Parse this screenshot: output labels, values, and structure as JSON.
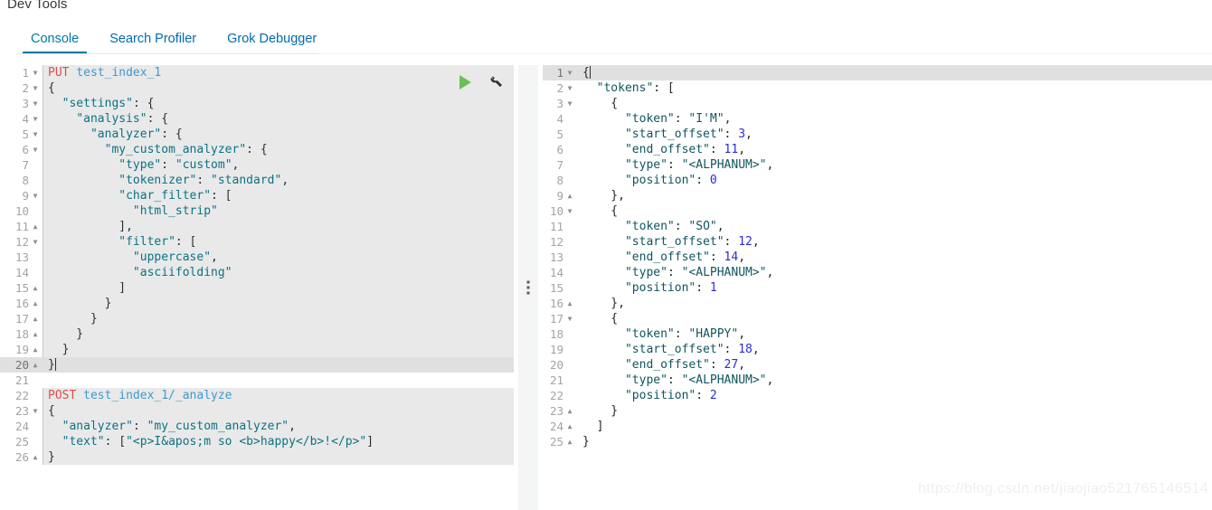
{
  "app": {
    "title": "Dev Tools"
  },
  "tabs": [
    {
      "label": "Console",
      "active": true
    },
    {
      "label": "Search Profiler",
      "active": false
    },
    {
      "label": "Grok Debugger",
      "active": false
    }
  ],
  "toolbar": {
    "play_label": "▶",
    "wrench_label": "🔧",
    "play_icon": "play-icon",
    "wrench_icon": "wrench-icon"
  },
  "request_editor": {
    "cursor_line": 20,
    "lines": [
      {
        "n": 1,
        "fold": "open",
        "text": "PUT test_index_1",
        "tokens": [
          {
            "t": "PUT",
            "c": "k-method"
          },
          {
            "t": " ",
            "c": "k-punc"
          },
          {
            "t": "test_index_1",
            "c": "k-url"
          }
        ]
      },
      {
        "n": 2,
        "fold": "open",
        "text": "{",
        "tokens": [
          {
            "t": "{",
            "c": "k-punc"
          }
        ]
      },
      {
        "n": 3,
        "fold": "open",
        "text": "  \"settings\": {",
        "tokens": [
          {
            "t": "  ",
            "c": "k-punc"
          },
          {
            "t": "\"settings\"",
            "c": "k-key"
          },
          {
            "t": ": {",
            "c": "k-punc"
          }
        ]
      },
      {
        "n": 4,
        "fold": "open",
        "text": "    \"analysis\": {",
        "tokens": [
          {
            "t": "    ",
            "c": "k-punc"
          },
          {
            "t": "\"analysis\"",
            "c": "k-key"
          },
          {
            "t": ": {",
            "c": "k-punc"
          }
        ]
      },
      {
        "n": 5,
        "fold": "open",
        "text": "      \"analyzer\": {",
        "tokens": [
          {
            "t": "      ",
            "c": "k-punc"
          },
          {
            "t": "\"analyzer\"",
            "c": "k-key"
          },
          {
            "t": ": {",
            "c": "k-punc"
          }
        ]
      },
      {
        "n": 6,
        "fold": "open",
        "text": "        \"my_custom_analyzer\": {",
        "tokens": [
          {
            "t": "        ",
            "c": "k-punc"
          },
          {
            "t": "\"my_custom_analyzer\"",
            "c": "k-key"
          },
          {
            "t": ": {",
            "c": "k-punc"
          }
        ]
      },
      {
        "n": 7,
        "fold": "none",
        "text": "          \"type\": \"custom\",",
        "tokens": [
          {
            "t": "          ",
            "c": "k-punc"
          },
          {
            "t": "\"type\"",
            "c": "k-key"
          },
          {
            "t": ": ",
            "c": "k-punc"
          },
          {
            "t": "\"custom\"",
            "c": "k-str"
          },
          {
            "t": ",",
            "c": "k-punc"
          }
        ]
      },
      {
        "n": 8,
        "fold": "none",
        "text": "          \"tokenizer\": \"standard\",",
        "tokens": [
          {
            "t": "          ",
            "c": "k-punc"
          },
          {
            "t": "\"tokenizer\"",
            "c": "k-key"
          },
          {
            "t": ": ",
            "c": "k-punc"
          },
          {
            "t": "\"standard\"",
            "c": "k-str"
          },
          {
            "t": ",",
            "c": "k-punc"
          }
        ]
      },
      {
        "n": 9,
        "fold": "open",
        "text": "          \"char_filter\": [",
        "tokens": [
          {
            "t": "          ",
            "c": "k-punc"
          },
          {
            "t": "\"char_filter\"",
            "c": "k-key"
          },
          {
            "t": ": [",
            "c": "k-punc"
          }
        ]
      },
      {
        "n": 10,
        "fold": "none",
        "text": "            \"html_strip\"",
        "tokens": [
          {
            "t": "            ",
            "c": "k-punc"
          },
          {
            "t": "\"html_strip\"",
            "c": "k-str"
          }
        ]
      },
      {
        "n": 11,
        "fold": "close",
        "text": "          ],",
        "tokens": [
          {
            "t": "          ],",
            "c": "k-punc"
          }
        ]
      },
      {
        "n": 12,
        "fold": "open",
        "text": "          \"filter\": [",
        "tokens": [
          {
            "t": "          ",
            "c": "k-punc"
          },
          {
            "t": "\"filter\"",
            "c": "k-key"
          },
          {
            "t": ": [",
            "c": "k-punc"
          }
        ]
      },
      {
        "n": 13,
        "fold": "none",
        "text": "            \"uppercase\",",
        "tokens": [
          {
            "t": "            ",
            "c": "k-punc"
          },
          {
            "t": "\"uppercase\"",
            "c": "k-str"
          },
          {
            "t": ",",
            "c": "k-punc"
          }
        ]
      },
      {
        "n": 14,
        "fold": "none",
        "text": "            \"asciifolding\"",
        "tokens": [
          {
            "t": "            ",
            "c": "k-punc"
          },
          {
            "t": "\"asciifolding\"",
            "c": "k-str"
          }
        ]
      },
      {
        "n": 15,
        "fold": "close",
        "text": "          ]",
        "tokens": [
          {
            "t": "          ]",
            "c": "k-punc"
          }
        ]
      },
      {
        "n": 16,
        "fold": "close",
        "text": "        }",
        "tokens": [
          {
            "t": "        }",
            "c": "k-punc"
          }
        ]
      },
      {
        "n": 17,
        "fold": "close",
        "text": "      }",
        "tokens": [
          {
            "t": "      }",
            "c": "k-punc"
          }
        ]
      },
      {
        "n": 18,
        "fold": "close",
        "text": "    }",
        "tokens": [
          {
            "t": "    }",
            "c": "k-punc"
          }
        ]
      },
      {
        "n": 19,
        "fold": "close",
        "text": "  }",
        "tokens": [
          {
            "t": "  }",
            "c": "k-punc"
          }
        ]
      },
      {
        "n": 20,
        "fold": "close",
        "text": "}",
        "tokens": [
          {
            "t": "}",
            "c": "k-punc"
          }
        ],
        "cursor": true
      },
      {
        "n": 21,
        "fold": "none",
        "text": "",
        "tokens": []
      },
      {
        "n": 22,
        "fold": "none",
        "text": "POST test_index_1/_analyze",
        "tokens": [
          {
            "t": "POST",
            "c": "k-method"
          },
          {
            "t": " ",
            "c": "k-punc"
          },
          {
            "t": "test_index_1/_analyze",
            "c": "k-url"
          }
        ]
      },
      {
        "n": 23,
        "fold": "open",
        "text": "{",
        "tokens": [
          {
            "t": "{",
            "c": "k-punc"
          }
        ]
      },
      {
        "n": 24,
        "fold": "none",
        "text": "  \"analyzer\": \"my_custom_analyzer\",",
        "tokens": [
          {
            "t": "  ",
            "c": "k-punc"
          },
          {
            "t": "\"analyzer\"",
            "c": "k-key"
          },
          {
            "t": ": ",
            "c": "k-punc"
          },
          {
            "t": "\"my_custom_analyzer\"",
            "c": "k-str"
          },
          {
            "t": ",",
            "c": "k-punc"
          }
        ]
      },
      {
        "n": 25,
        "fold": "none",
        "text": "  \"text\": [\"<p>I&apos;m so <b>happy</b>!</p>\"]",
        "tokens": [
          {
            "t": "  ",
            "c": "k-punc"
          },
          {
            "t": "\"text\"",
            "c": "k-key"
          },
          {
            "t": ": [",
            "c": "k-punc"
          },
          {
            "t": "\"<p>I&apos;m so <b>happy</b>!</p>\"",
            "c": "k-str"
          },
          {
            "t": "]",
            "c": "k-punc"
          }
        ]
      },
      {
        "n": 26,
        "fold": "close",
        "text": "}",
        "tokens": [
          {
            "t": "}",
            "c": "k-punc"
          }
        ]
      }
    ]
  },
  "response_editor": {
    "cursor_line": 1,
    "lines": [
      {
        "n": 1,
        "fold": "open",
        "text": "{",
        "tokens": [
          {
            "t": "{",
            "c": "r-punc"
          }
        ],
        "cursor": true
      },
      {
        "n": 2,
        "fold": "open",
        "text": "  \"tokens\": [",
        "tokens": [
          {
            "t": "  ",
            "c": "r-punc"
          },
          {
            "t": "\"tokens\"",
            "c": "r-key"
          },
          {
            "t": ": [",
            "c": "r-punc"
          }
        ]
      },
      {
        "n": 3,
        "fold": "open",
        "text": "    {",
        "tokens": [
          {
            "t": "    {",
            "c": "r-punc"
          }
        ]
      },
      {
        "n": 4,
        "fold": "none",
        "text": "      \"token\": \"I'M\",",
        "tokens": [
          {
            "t": "      ",
            "c": "r-punc"
          },
          {
            "t": "\"token\"",
            "c": "r-key"
          },
          {
            "t": ": ",
            "c": "r-punc"
          },
          {
            "t": "\"I'M\"",
            "c": "r-str"
          },
          {
            "t": ",",
            "c": "r-punc"
          }
        ]
      },
      {
        "n": 5,
        "fold": "none",
        "text": "      \"start_offset\": 3,",
        "tokens": [
          {
            "t": "      ",
            "c": "r-punc"
          },
          {
            "t": "\"start_offset\"",
            "c": "r-key"
          },
          {
            "t": ": ",
            "c": "r-punc"
          },
          {
            "t": "3",
            "c": "r-num"
          },
          {
            "t": ",",
            "c": "r-punc"
          }
        ]
      },
      {
        "n": 6,
        "fold": "none",
        "text": "      \"end_offset\": 11,",
        "tokens": [
          {
            "t": "      ",
            "c": "r-punc"
          },
          {
            "t": "\"end_offset\"",
            "c": "r-key"
          },
          {
            "t": ": ",
            "c": "r-punc"
          },
          {
            "t": "11",
            "c": "r-num"
          },
          {
            "t": ",",
            "c": "r-punc"
          }
        ]
      },
      {
        "n": 7,
        "fold": "none",
        "text": "      \"type\": \"<ALPHANUM>\",",
        "tokens": [
          {
            "t": "      ",
            "c": "r-punc"
          },
          {
            "t": "\"type\"",
            "c": "r-key"
          },
          {
            "t": ": ",
            "c": "r-punc"
          },
          {
            "t": "\"<ALPHANUM>\"",
            "c": "r-str"
          },
          {
            "t": ",",
            "c": "r-punc"
          }
        ]
      },
      {
        "n": 8,
        "fold": "none",
        "text": "      \"position\": 0",
        "tokens": [
          {
            "t": "      ",
            "c": "r-punc"
          },
          {
            "t": "\"position\"",
            "c": "r-key"
          },
          {
            "t": ": ",
            "c": "r-punc"
          },
          {
            "t": "0",
            "c": "r-num"
          }
        ]
      },
      {
        "n": 9,
        "fold": "close",
        "text": "    },",
        "tokens": [
          {
            "t": "    },",
            "c": "r-punc"
          }
        ]
      },
      {
        "n": 10,
        "fold": "open",
        "text": "    {",
        "tokens": [
          {
            "t": "    {",
            "c": "r-punc"
          }
        ]
      },
      {
        "n": 11,
        "fold": "none",
        "text": "      \"token\": \"SO\",",
        "tokens": [
          {
            "t": "      ",
            "c": "r-punc"
          },
          {
            "t": "\"token\"",
            "c": "r-key"
          },
          {
            "t": ": ",
            "c": "r-punc"
          },
          {
            "t": "\"SO\"",
            "c": "r-str"
          },
          {
            "t": ",",
            "c": "r-punc"
          }
        ]
      },
      {
        "n": 12,
        "fold": "none",
        "text": "      \"start_offset\": 12,",
        "tokens": [
          {
            "t": "      ",
            "c": "r-punc"
          },
          {
            "t": "\"start_offset\"",
            "c": "r-key"
          },
          {
            "t": ": ",
            "c": "r-punc"
          },
          {
            "t": "12",
            "c": "r-num"
          },
          {
            "t": ",",
            "c": "r-punc"
          }
        ]
      },
      {
        "n": 13,
        "fold": "none",
        "text": "      \"end_offset\": 14,",
        "tokens": [
          {
            "t": "      ",
            "c": "r-punc"
          },
          {
            "t": "\"end_offset\"",
            "c": "r-key"
          },
          {
            "t": ": ",
            "c": "r-punc"
          },
          {
            "t": "14",
            "c": "r-num"
          },
          {
            "t": ",",
            "c": "r-punc"
          }
        ]
      },
      {
        "n": 14,
        "fold": "none",
        "text": "      \"type\": \"<ALPHANUM>\",",
        "tokens": [
          {
            "t": "      ",
            "c": "r-punc"
          },
          {
            "t": "\"type\"",
            "c": "r-key"
          },
          {
            "t": ": ",
            "c": "r-punc"
          },
          {
            "t": "\"<ALPHANUM>\"",
            "c": "r-str"
          },
          {
            "t": ",",
            "c": "r-punc"
          }
        ]
      },
      {
        "n": 15,
        "fold": "none",
        "text": "      \"position\": 1",
        "tokens": [
          {
            "t": "      ",
            "c": "r-punc"
          },
          {
            "t": "\"position\"",
            "c": "r-key"
          },
          {
            "t": ": ",
            "c": "r-punc"
          },
          {
            "t": "1",
            "c": "r-num"
          }
        ]
      },
      {
        "n": 16,
        "fold": "close",
        "text": "    },",
        "tokens": [
          {
            "t": "    },",
            "c": "r-punc"
          }
        ]
      },
      {
        "n": 17,
        "fold": "open",
        "text": "    {",
        "tokens": [
          {
            "t": "    {",
            "c": "r-punc"
          }
        ]
      },
      {
        "n": 18,
        "fold": "none",
        "text": "      \"token\": \"HAPPY\",",
        "tokens": [
          {
            "t": "      ",
            "c": "r-punc"
          },
          {
            "t": "\"token\"",
            "c": "r-key"
          },
          {
            "t": ": ",
            "c": "r-punc"
          },
          {
            "t": "\"HAPPY\"",
            "c": "r-str"
          },
          {
            "t": ",",
            "c": "r-punc"
          }
        ]
      },
      {
        "n": 19,
        "fold": "none",
        "text": "      \"start_offset\": 18,",
        "tokens": [
          {
            "t": "      ",
            "c": "r-punc"
          },
          {
            "t": "\"start_offset\"",
            "c": "r-key"
          },
          {
            "t": ": ",
            "c": "r-punc"
          },
          {
            "t": "18",
            "c": "r-num"
          },
          {
            "t": ",",
            "c": "r-punc"
          }
        ]
      },
      {
        "n": 20,
        "fold": "none",
        "text": "      \"end_offset\": 27,",
        "tokens": [
          {
            "t": "      ",
            "c": "r-punc"
          },
          {
            "t": "\"end_offset\"",
            "c": "r-key"
          },
          {
            "t": ": ",
            "c": "r-punc"
          },
          {
            "t": "27",
            "c": "r-num"
          },
          {
            "t": ",",
            "c": "r-punc"
          }
        ]
      },
      {
        "n": 21,
        "fold": "none",
        "text": "      \"type\": \"<ALPHANUM>\",",
        "tokens": [
          {
            "t": "      ",
            "c": "r-punc"
          },
          {
            "t": "\"type\"",
            "c": "r-key"
          },
          {
            "t": ": ",
            "c": "r-punc"
          },
          {
            "t": "\"<ALPHANUM>\"",
            "c": "r-str"
          },
          {
            "t": ",",
            "c": "r-punc"
          }
        ]
      },
      {
        "n": 22,
        "fold": "none",
        "text": "      \"position\": 2",
        "tokens": [
          {
            "t": "      ",
            "c": "r-punc"
          },
          {
            "t": "\"position\"",
            "c": "r-key"
          },
          {
            "t": ": ",
            "c": "r-punc"
          },
          {
            "t": "2",
            "c": "r-num"
          }
        ]
      },
      {
        "n": 23,
        "fold": "close",
        "text": "    }",
        "tokens": [
          {
            "t": "    }",
            "c": "r-punc"
          }
        ]
      },
      {
        "n": 24,
        "fold": "close",
        "text": "  ]",
        "tokens": [
          {
            "t": "  ]",
            "c": "r-punc"
          }
        ]
      },
      {
        "n": 25,
        "fold": "close",
        "text": "}",
        "tokens": [
          {
            "t": "}",
            "c": "r-punc"
          }
        ]
      }
    ]
  },
  "splitter": {
    "grip_icon": "drag-handle-icon"
  },
  "watermark": {
    "text": "https://blog.csdn.net/jiaojiao521765146514"
  },
  "colors": {
    "accent": "#0079a5",
    "link": "#006bb4",
    "method": "#d9504a",
    "url": "#3d9ad1",
    "string": "#0b7285",
    "number": "#2b2bd6",
    "run_button": "#6cbf55",
    "active_line": "#e0e0e0",
    "request_block": "#e9e9e9"
  }
}
